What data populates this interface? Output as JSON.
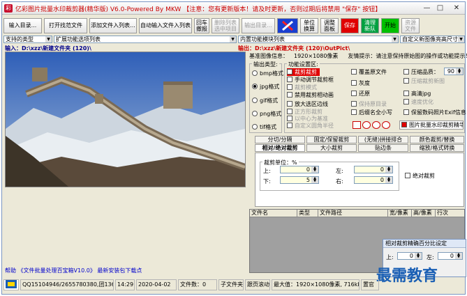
{
  "window": {
    "title": "亿彩图片批量水印裁剪器(精华版) V6.0-Powered By MKW 【注意：您有更新版本！请及时更新，否则过期后将禁用 \"保存\" 按钮】",
    "controls": {
      "min": "—",
      "max": "□",
      "close": "✕"
    }
  },
  "toolbar": {
    "input_dir": "输入目录...",
    "open_files": "打开找范文件",
    "add_files": "添加文件入列表...",
    "auto_input": "自动输入文件入列表",
    "revert_top": "回车",
    "revert_bottom": "撤报",
    "delete_top": "删除列表",
    "delete_bottom": "选中项目",
    "output_dir": "输出目录...",
    "unit_top": "单位",
    "unit_bottom": "换算",
    "watermark_top": "调整",
    "watermark_bottom": "面板",
    "save": "保存",
    "clear_top": "清理",
    "clear_bottom": "新队",
    "start": "开始",
    "resource_top": "资源",
    "resource_bottom": "文件"
  },
  "filters": {
    "type_select": "支持的类型",
    "ext_option": "扩展功能选项列表",
    "content_select": "内置功能模块列表",
    "custom_select": "自定义新图像亮高尺寸"
  },
  "input_path": "输入：D:\\xzz\\新建文件夹 (120)\\",
  "output_path": "输出：D:\\xzz\\新建文件夹 (120)\\OutPict\\",
  "info": {
    "base_label": "基准图像信息：",
    "base_value": "1920×1080像素",
    "tip_label": "友情提示：",
    "tip_value": "请注意保持原始图的操作或功能提示！"
  },
  "output_format": {
    "title": "输出类型:",
    "options": [
      "bmp格式",
      "jpg格式",
      "gif格式",
      "png格式",
      "tif格式"
    ],
    "selected": "jpg格式"
  },
  "func_settings": {
    "title": "功能设置区:",
    "col1": [
      "裁剪裁剪",
      "手动调节裁剪框",
      "裁剪模式",
      "禁用裁剪相动画",
      "放大选区边线",
      "正方形裁剪",
      "以中心为基准",
      "自定义圆角半径"
    ],
    "col2": [
      "覆盖原文件",
      "灰度",
      "还原",
      "保持原目录",
      "后缀名全小写"
    ],
    "col3": [
      "压缩品质：",
      "压缩裁剪新图",
      "高清jpg",
      "速度优化",
      "保留数码照片Exif信息"
    ],
    "quality_value": "90",
    "bottom_label": "图片批量水印裁剪精华版V6"
  },
  "tabs_row1": [
    "分切/分隔",
    "固定/保留裁剪",
    "(无缝)拼接排合",
    "颜色裁剪/替换"
  ],
  "tabs_row2": [
    "相对/绝对裁剪",
    "大小裁剪",
    "贴边条",
    "缩放/格式转换"
  ],
  "crop": {
    "group_title": "裁剪单位：%",
    "top_label": "上:",
    "top_value": "0",
    "bottom_label": "下:",
    "bottom_value": "5",
    "left_label": "左:",
    "left_value": "0",
    "right_label": "右:",
    "right_value": "0",
    "absolute": "绝对裁剪"
  },
  "file_grid": {
    "columns": [
      "文件名",
      "类型",
      "文件路径",
      "宽/像素",
      "高/像素",
      "行次"
    ]
  },
  "dialog": {
    "title": "相对裁剪精确百分比设定",
    "top_label": "上:",
    "top_value": "0",
    "left_label": "左:",
    "left_value": "0"
  },
  "promo": "帮助 《文件批量处理百宝箱V10.0》 最新安装包下载点",
  "status": {
    "qq": "QQ15104946/2655780380,团1364100T723",
    "time": "14:29",
    "date": "2020-04-02",
    "file_count_label": "文件数：",
    "file_count": "0",
    "subfolder": "子文件夹",
    "trace": "跟页滚动",
    "max_info": "最大值：1920×1080像素, 716kb",
    "reset": "置官"
  },
  "watermark_text": "最需教育",
  "colors": {
    "save_bg": "#e00000",
    "start_bg": "#00c000",
    "clear_bg": "#00a040",
    "selected_item": "#e00000",
    "path_blue": "#00008b"
  }
}
